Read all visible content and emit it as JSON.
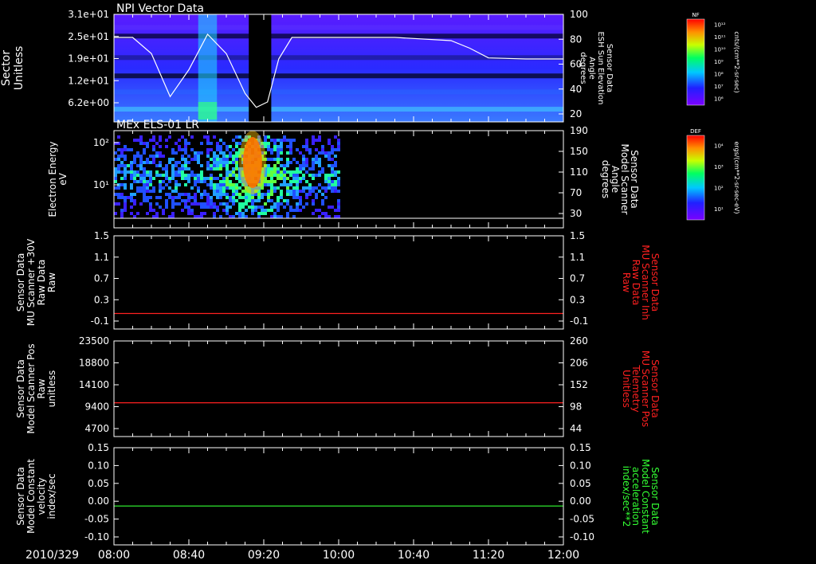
{
  "colors": {
    "background": "#000000",
    "foreground": "#ffffff",
    "red_series": "#ff2020",
    "green_series": "#33ff33"
  },
  "time_axis": {
    "date_label": "2010/329",
    "ticks": [
      "08:00",
      "08:40",
      "09:20",
      "10:00",
      "10:40",
      "11:20",
      "12:00"
    ],
    "range": [
      "08:00",
      "12:00"
    ]
  },
  "chart_data": [
    {
      "type": "heatmap",
      "title": "NPI Vector Data",
      "ylabel": "Sector Unitless",
      "yticks": [
        "3.1e+01",
        "2.5e+01",
        "1.9e+01",
        "1.2e+01",
        "6.2e+00"
      ],
      "y2label": [
        "Sensor Data",
        "ESH Sun Elevation",
        "Angle",
        "degrees"
      ],
      "y2ticks": [
        "100",
        "80",
        "60",
        "40",
        "20"
      ],
      "data_gap": [
        "09:12",
        "09:24"
      ],
      "overlay_line": {
        "name": "ESH Sun Elevation Angle",
        "x": [
          "08:00",
          "08:10",
          "08:20",
          "08:30",
          "08:40",
          "08:50",
          "09:00",
          "09:10",
          "09:16",
          "09:22",
          "09:28",
          "09:35",
          "09:45",
          "10:00",
          "10:30",
          "11:00",
          "11:10",
          "11:20",
          "11:40",
          "12:00"
        ],
        "y": [
          80,
          80,
          65,
          25,
          50,
          83,
          65,
          28,
          15,
          20,
          60,
          80,
          80,
          80,
          80,
          77,
          70,
          61,
          60,
          60
        ]
      },
      "colorbar": {
        "label": "NF",
        "units": "cnts/(cm**2-sr-sec)",
        "ticks": [
          "10¹²",
          "10¹¹",
          "10¹⁰",
          "10⁹",
          "10⁸",
          "10⁷",
          "10⁶"
        ]
      }
    },
    {
      "type": "heatmap",
      "title": "MEx ELS-01 LR",
      "ylabel": [
        "Electron Energy",
        "eV"
      ],
      "yticks": [
        "10²",
        "10¹"
      ],
      "y2label": [
        "Sensor Data",
        "Model Scanner",
        "Angle",
        "degrees"
      ],
      "y2ticks": [
        "190",
        "150",
        "110",
        "70",
        "30"
      ],
      "data_range": [
        "08:00",
        "10:00"
      ],
      "peak_time": "09:14",
      "colorbar": {
        "label": "DEF",
        "units": "ergs/(cm**2-sr-sec-eV)",
        "ticks": [
          "10⁴",
          "10³",
          "10²",
          "10¹"
        ]
      }
    },
    {
      "type": "line",
      "ylabel": [
        "Sensor Data",
        "MU Scanner +30V",
        "Raw Data",
        "Raw"
      ],
      "yticks": [
        "1.5",
        "1.1",
        "0.7",
        "0.3",
        "-0.1"
      ],
      "ylim": [
        -0.3,
        1.5
      ],
      "y2label": [
        "Sensor Data",
        "MU Scanner Inh",
        "Raw Data",
        "Raw"
      ],
      "y2ticks": [
        "1.5",
        "1.1",
        "0.7",
        "0.3",
        "-0.1"
      ],
      "series": [
        {
          "x": [
            "08:00",
            "12:00"
          ],
          "y": [
            0.0,
            0.0
          ]
        }
      ]
    },
    {
      "type": "line",
      "ylabel": [
        "Sensor Data",
        "Model Scanner Pos",
        "Raw",
        "unitless"
      ],
      "yticks": [
        "23500",
        "18800",
        "14100",
        "9400",
        "4700"
      ],
      "ylim": [
        0,
        23500
      ],
      "y2label": [
        "Sensor Data",
        "MU Scanner Pos",
        "Telemetry",
        "Unitless"
      ],
      "y2ticks": [
        "260",
        "206",
        "152",
        "98",
        "44"
      ],
      "series": [
        {
          "x": [
            "08:00",
            "12:00"
          ],
          "y": [
            8300,
            8300
          ]
        }
      ]
    },
    {
      "type": "line",
      "ylabel": [
        "Sensor Data",
        "Model Constant",
        "velocity",
        "index/sec"
      ],
      "yticks": [
        "0.15",
        "0.10",
        "0.05",
        "0.00",
        "-0.05",
        "-0.10"
      ],
      "ylim": [
        -0.1,
        0.15
      ],
      "y2label": [
        "Sensor Data",
        "Model Constant",
        "acceleration",
        "index/sec**2"
      ],
      "y2ticks": [
        "0.15",
        "0.10",
        "0.05",
        "0.00",
        "-0.05",
        "-0.10"
      ],
      "series": [
        {
          "x": [
            "08:00",
            "12:00"
          ],
          "y": [
            0.0,
            0.0
          ]
        }
      ]
    }
  ]
}
